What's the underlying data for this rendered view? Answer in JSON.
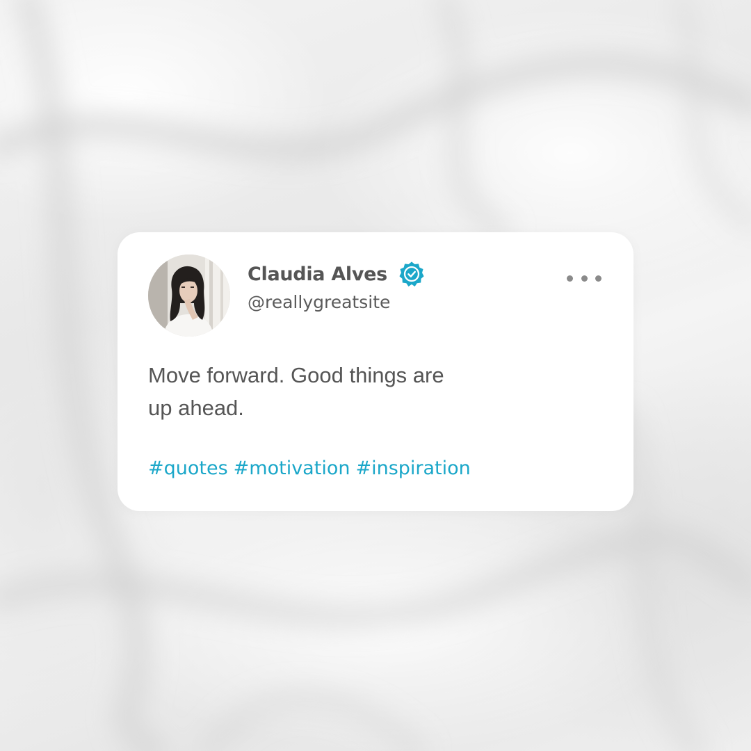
{
  "post": {
    "author_name": "Claudia Alves",
    "handle": "@reallygreatsite",
    "verified": true,
    "text_line1": "Move forward. Good things are",
    "text_line2": "up ahead.",
    "hashtags": [
      "#quotes",
      "#motivation",
      "#inspiration"
    ]
  },
  "icons": {
    "verified": "verified-badge-icon",
    "more": "more-options-icon"
  },
  "colors": {
    "accent": "#1BA7C9",
    "text": "#555555",
    "card": "#FFFFFF"
  }
}
